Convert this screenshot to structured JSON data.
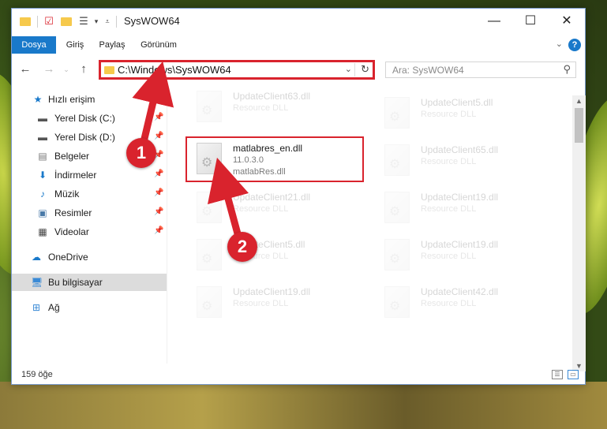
{
  "window": {
    "title": "SysWOW64"
  },
  "ribbon": {
    "tabs": [
      "Dosya",
      "Giriş",
      "Paylaş",
      "Görünüm"
    ]
  },
  "nav": {
    "address": "C:\\Windows\\SysWOW64",
    "search_placeholder": "Ara: SysWOW64"
  },
  "sidebar": {
    "items": [
      {
        "label": "Hızlı erişim",
        "icon": "star-icon",
        "pinned": false
      },
      {
        "label": "Yerel Disk (C:)",
        "icon": "drive-icon",
        "pinned": true
      },
      {
        "label": "Yerel Disk (D:)",
        "icon": "drive-icon",
        "pinned": true
      },
      {
        "label": "Belgeler",
        "icon": "documents-icon",
        "pinned": true
      },
      {
        "label": "İndirmeler",
        "icon": "download-icon",
        "pinned": true
      },
      {
        "label": "Müzik",
        "icon": "music-icon",
        "pinned": true
      },
      {
        "label": "Resimler",
        "icon": "pictures-icon",
        "pinned": true
      },
      {
        "label": "Videolar",
        "icon": "videos-icon",
        "pinned": true
      },
      {
        "label": "OneDrive",
        "icon": "cloud-icon",
        "pinned": false
      },
      {
        "label": "Bu bilgisayar",
        "icon": "computer-icon",
        "pinned": false
      },
      {
        "label": "Ağ",
        "icon": "network-icon",
        "pinned": false
      }
    ]
  },
  "files": {
    "highlighted": {
      "name": "matlabres_en.dll",
      "version": "11.0.3.0",
      "description": "matlabRes.dll"
    },
    "left": [
      {
        "name": "UpdateClient63.dll",
        "type": "Resource DLL"
      },
      {
        "name": "UpdateClient21.dll",
        "type": "Resource DLL"
      },
      {
        "name": "UpdateClient5.dll",
        "type": "Resource DLL"
      },
      {
        "name": "UpdateClient19.dll",
        "type": "Resource DLL"
      }
    ],
    "right": [
      {
        "name": "UpdateClient5.dll",
        "type": "Resource DLL"
      },
      {
        "name": "UpdateClient65.dll",
        "type": "Resource DLL"
      },
      {
        "name": "UpdateClient19.dll",
        "type": "Resource DLL"
      },
      {
        "name": "UpdateClient19.dll",
        "type": "Resource DLL"
      },
      {
        "name": "UpdateClient42.dll",
        "type": "Resource DLL"
      }
    ]
  },
  "status": {
    "count": "159 öğe"
  },
  "annotations": {
    "step1": "1",
    "step2": "2"
  },
  "colors": {
    "accent": "#1979ca",
    "highlight": "#d9232d"
  }
}
